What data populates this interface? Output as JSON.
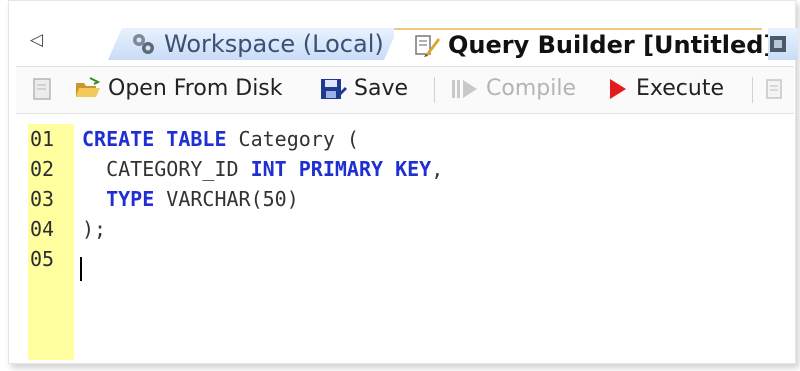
{
  "tabs": {
    "scroll_left_glyph": "◁",
    "workspace_label": "Workspace (Local)",
    "query_label": "Query Builder [Untitled]"
  },
  "toolbar": {
    "open_label": "Open From Disk",
    "save_label": "Save",
    "compile_label": "Compile",
    "execute_label": "Execute"
  },
  "editor": {
    "line_numbers": [
      "01",
      "02",
      "03",
      "04",
      "05"
    ],
    "lines": [
      [
        {
          "t": "CREATE TABLE",
          "kw": true
        },
        {
          "t": " Category (",
          "kw": false
        }
      ],
      [
        {
          "t": "  CATEGORY_ID ",
          "kw": false
        },
        {
          "t": "INT PRIMARY KEY",
          "kw": true
        },
        {
          "t": ",",
          "kw": false
        }
      ],
      [
        {
          "t": "  ",
          "kw": false
        },
        {
          "t": "TYPE",
          "kw": true
        },
        {
          "t": " VARCHAR(50)",
          "kw": false
        }
      ],
      [
        {
          "t": ");",
          "kw": false
        }
      ],
      []
    ]
  },
  "colors": {
    "keyword": "#1f2fd2",
    "gutter": "#ffffa0",
    "tab_inactive": "#c9dcf6"
  },
  "icons": [
    "tab-scroll-left-icon",
    "workspace-icon",
    "query-builder-icon",
    "new-file-icon",
    "open-folder-icon",
    "save-disk-icon",
    "compile-icon",
    "execute-icon"
  ]
}
